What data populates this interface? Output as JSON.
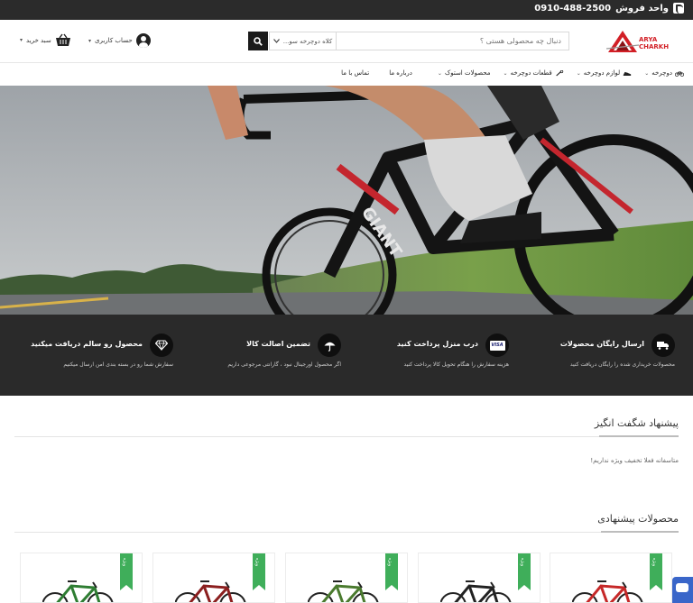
{
  "topbar": {
    "phone": "0910-488-2500",
    "sales_label": "واحد فروش",
    "icon": "phone-icon"
  },
  "header": {
    "logo_line1": "ARYA",
    "logo_line2": "CHARKH",
    "search_placeholder": "دنبال چه محصولی هستی ؟",
    "search_category": "کلاه دوچرخه سو...",
    "account_label": "حساب کاربری",
    "cart_label": "سبد خرید"
  },
  "nav": {
    "items": [
      {
        "label": "دوچرخه",
        "icon": "bicycle-icon",
        "dropdown": true
      },
      {
        "label": "لوازم دوچرخه",
        "icon": "shoe-icon",
        "dropdown": true
      },
      {
        "label": "قطعات دوچرخه",
        "icon": "wrench-icon",
        "dropdown": true
      },
      {
        "label": "محصولات استوک",
        "dropdown": true
      },
      {
        "label": "درباره ما",
        "dropdown": false
      },
      {
        "label": "تماس با ما",
        "dropdown": false
      }
    ]
  },
  "features": [
    {
      "title": "ارسال رایگان محصولات",
      "desc": "محصولات خریداری شده را رایگان دریافت کنید",
      "icon": "truck-icon"
    },
    {
      "title": "درب منزل پرداخت کنید",
      "desc": "هزینه سفارش را هنگام تحویل کالا پرداخت کنید",
      "icon": "visa-card-icon",
      "icon_text": "VISA"
    },
    {
      "title": "تضمین اصالت کالا",
      "desc": "اگر محصول اورجینال نبود ، گارانتی مرجوعی داریم",
      "icon": "umbrella-icon"
    },
    {
      "title": "محصول رو سالم دریافت میکنید",
      "desc": "سفارش شما رو در بسته بندی امن ارسال میکنیم",
      "icon": "diamond-icon"
    }
  ],
  "amazing_offer": {
    "title": "پیشنهاد شگفت انگیز",
    "empty_note": "متاسفانه فعلا تخفیف ویژه نداریم!"
  },
  "suggested": {
    "title": "محصولات پیشنهادی",
    "ribbon": "ویژه",
    "cards": [
      {
        "bike_color": "#c62828"
      },
      {
        "bike_color": "#222222"
      },
      {
        "bike_color": "#4a7a2e"
      },
      {
        "bike_color": "#8b1e1e"
      },
      {
        "bike_color": "#2e7d32"
      }
    ]
  },
  "colors": {
    "topbar_bg": "#2b2b2b",
    "features_bg": "#2a2a2a",
    "ribbon_green": "#3fae5a",
    "brand_red": "#d21f26"
  }
}
